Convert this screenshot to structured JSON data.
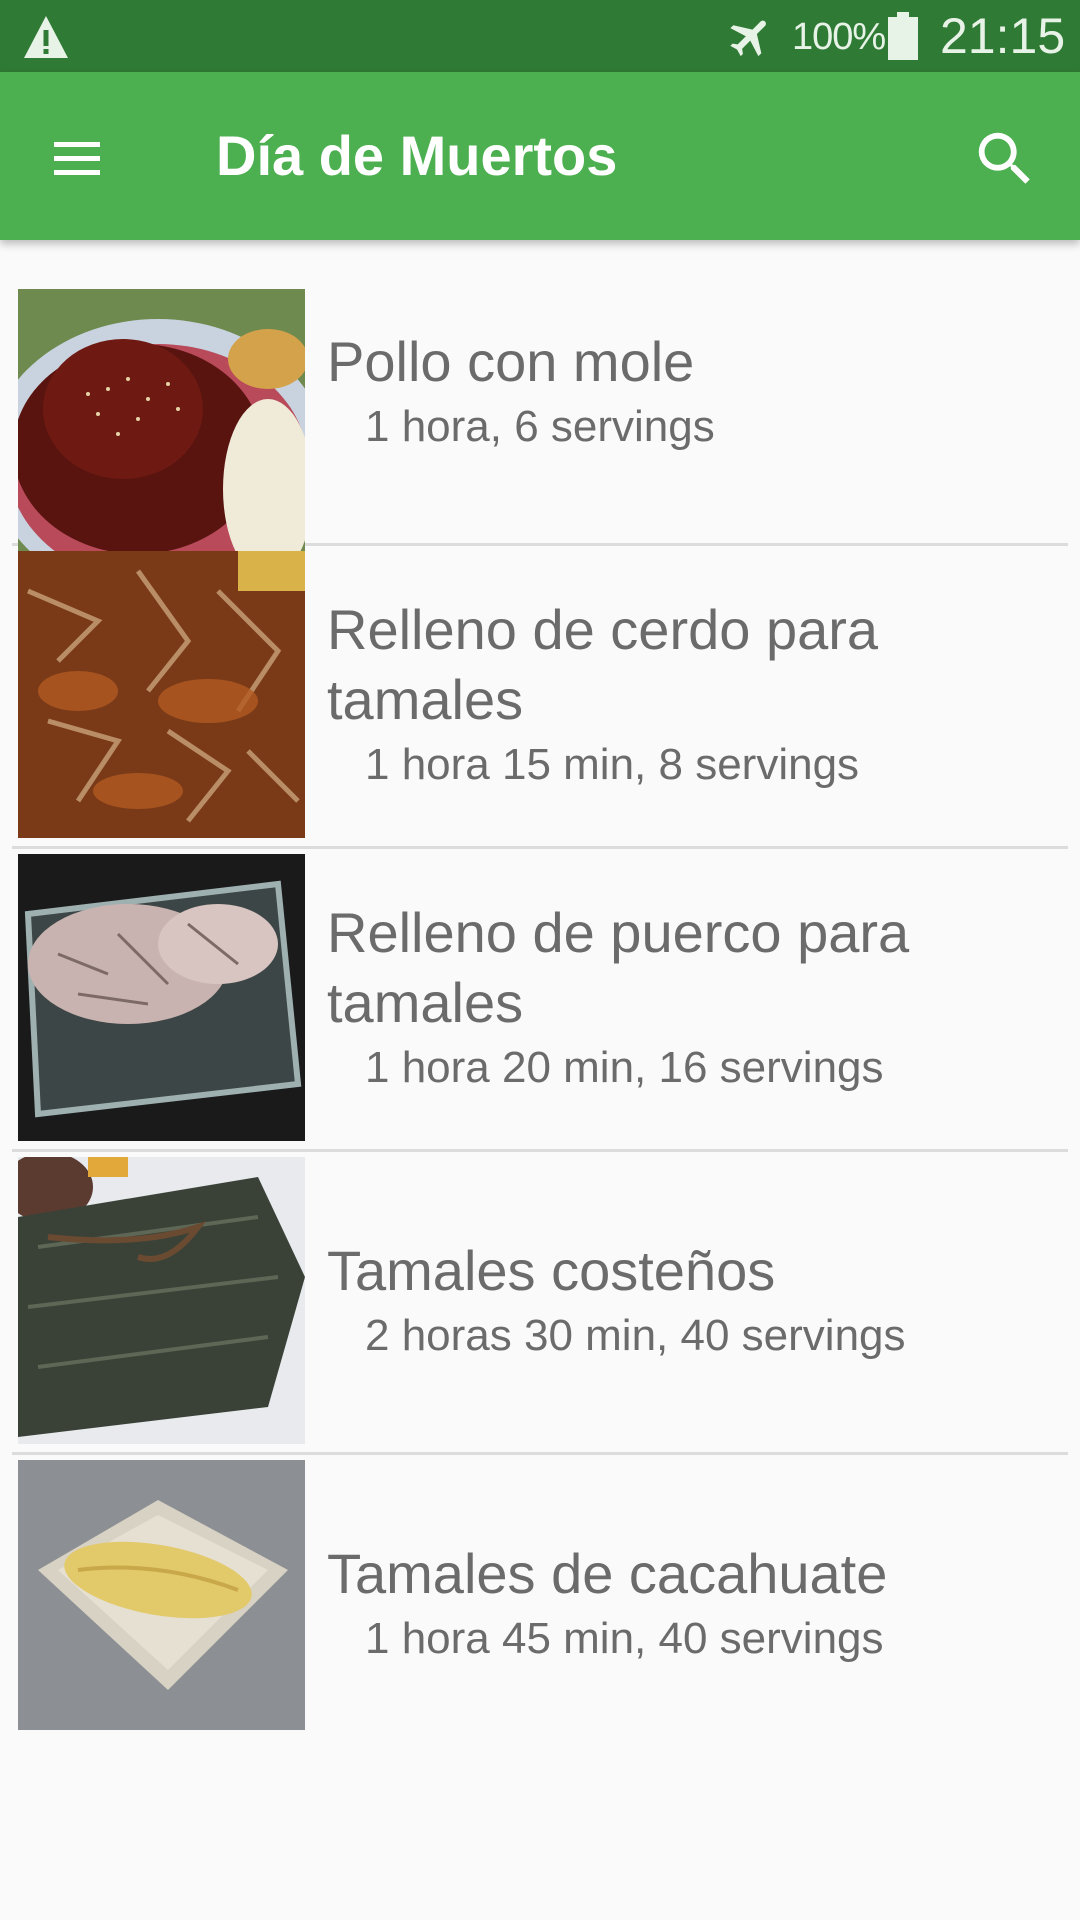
{
  "status_bar": {
    "warning_icon": "warning-triangle-icon",
    "airplane_icon": "airplane-mode-icon",
    "battery_percent": "100%",
    "battery_icon": "battery-full-icon",
    "time": "21:15"
  },
  "app_bar": {
    "menu_icon": "hamburger-menu-icon",
    "title": "Día de Muertos",
    "search_icon": "search-icon",
    "color": "#4caf50"
  },
  "recipes": [
    {
      "title": "Pollo con mole",
      "meta": "1 hora, 6 servings",
      "image": "pollo-con-mole-photo"
    },
    {
      "title": "Relleno de cerdo para tamales",
      "meta": "1 hora 15 min, 8 servings",
      "image": "shredded-pork-photo"
    },
    {
      "title": "Relleno de puerco para tamales",
      "meta": "1 hora 20 min, 16 servings",
      "image": "pork-in-glass-dish-photo"
    },
    {
      "title": "Tamales costeños",
      "meta": "2 horas 30 min, 40 servings",
      "image": "banana-leaf-tamale-photo"
    },
    {
      "title": "Tamales de cacahuate",
      "meta": "1 hora 45 min, 40 servings",
      "image": "tamal-on-plate-photo"
    }
  ]
}
